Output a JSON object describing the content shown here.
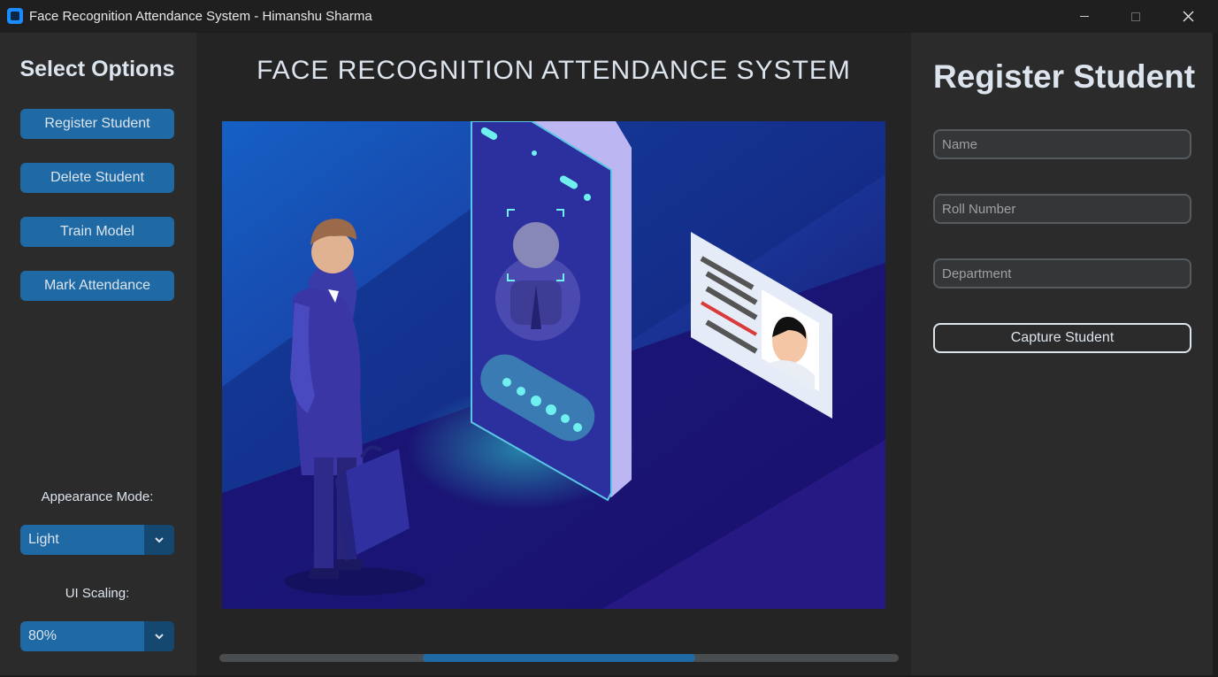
{
  "window": {
    "title": "Face Recognition Attendance System - Himanshu Sharma",
    "controls": [
      "minimize-icon",
      "maximize-icon",
      "close-icon"
    ]
  },
  "sidebar": {
    "title": "Select Options",
    "buttons": [
      "Register Student",
      "Delete Student",
      "Train Model",
      "Mark Attendance"
    ],
    "appearance_label": "Appearance Mode:",
    "appearance_value": "Light",
    "scaling_label": "UI Scaling:",
    "scaling_value": "80%"
  },
  "main": {
    "title": "FACE RECOGNITION ATTENDANCE SYSTEM",
    "image": "face-recognition-illustration",
    "progress": {
      "start": 0.3,
      "end": 0.7
    }
  },
  "register": {
    "title": "Register Student",
    "name_placeholder": "Name",
    "roll_placeholder": "Roll Number",
    "department_placeholder": "Department",
    "capture_label": "Capture Student"
  },
  "colors": {
    "accent": "#1f6aa5",
    "accent_dark": "#144870",
    "panel": "#2b2b2b",
    "background": "#242424",
    "text": "#dce4ee"
  }
}
